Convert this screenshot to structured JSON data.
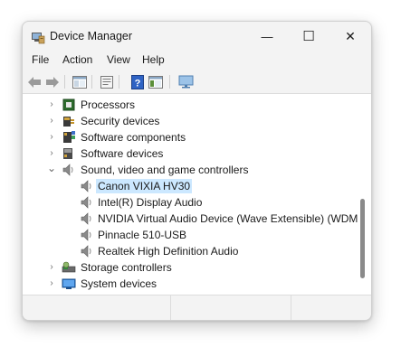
{
  "window": {
    "title": "Device Manager",
    "minimize_glyph": "—",
    "maximize_glyph": "☐",
    "close_glyph": "✕"
  },
  "menu": [
    "File",
    "Action",
    "View",
    "Help"
  ],
  "toolbar": [
    {
      "icon": "back-arrow-icon"
    },
    {
      "icon": "forward-arrow-icon"
    },
    {
      "icon": "show-hide-tree-icon"
    },
    {
      "icon": "properties-icon"
    },
    {
      "icon": "help-icon"
    },
    {
      "icon": "view-resources-icon"
    },
    {
      "icon": "monitor-icon"
    }
  ],
  "tree": {
    "categories": [
      {
        "label": "Processors",
        "icon": "processor-icon",
        "expanded": false
      },
      {
        "label": "Security devices",
        "icon": "security-device-icon",
        "expanded": false
      },
      {
        "label": "Software components",
        "icon": "software-component-icon",
        "expanded": false
      },
      {
        "label": "Software devices",
        "icon": "software-device-icon",
        "expanded": false
      },
      {
        "label": "Sound, video and game controllers",
        "icon": "speaker-icon",
        "expanded": true,
        "children": [
          {
            "label": "Canon VIXIA HV30",
            "icon": "speaker-icon",
            "selected": true
          },
          {
            "label": "Intel(R) Display Audio",
            "icon": "speaker-icon"
          },
          {
            "label": "NVIDIA Virtual Audio Device (Wave Extensible) (WDM)",
            "icon": "speaker-icon"
          },
          {
            "label": "Pinnacle 510-USB",
            "icon": "speaker-icon"
          },
          {
            "label": "Realtek High Definition Audio",
            "icon": "speaker-icon"
          }
        ]
      },
      {
        "label": "Storage controllers",
        "icon": "storage-controller-icon",
        "expanded": false
      },
      {
        "label": "System devices",
        "icon": "system-device-icon",
        "expanded": false
      }
    ]
  },
  "colors": {
    "selection": "#cce8ff",
    "window_bg": "#f3f3f3",
    "tree_bg": "#ffffff"
  }
}
